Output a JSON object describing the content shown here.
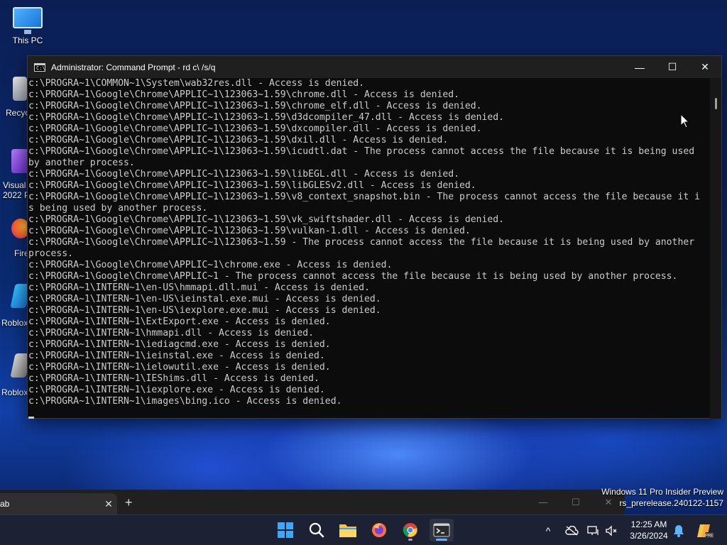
{
  "desktop": {
    "icons": [
      {
        "label": "This PC"
      },
      {
        "label": "Recyc"
      },
      {
        "label": "Visual\n2022 P"
      },
      {
        "label": "Fire"
      },
      {
        "label": "Roblox"
      },
      {
        "label": "Roblox"
      }
    ]
  },
  "window": {
    "title": "Administrator: Command Prompt - rd  c\\ /s/q",
    "minimize_symbol": "—",
    "maximize_symbol": "☐",
    "close_symbol": "✕"
  },
  "console": {
    "lines": [
      "c:\\PROGRA~1\\COMMON~1\\System\\wab32res.dll - Access is denied.",
      "c:\\PROGRA~1\\Google\\Chrome\\APPLIC~1\\123063~1.59\\chrome.dll - Access is denied.",
      "c:\\PROGRA~1\\Google\\Chrome\\APPLIC~1\\123063~1.59\\chrome_elf.dll - Access is denied.",
      "c:\\PROGRA~1\\Google\\Chrome\\APPLIC~1\\123063~1.59\\d3dcompiler_47.dll - Access is denied.",
      "c:\\PROGRA~1\\Google\\Chrome\\APPLIC~1\\123063~1.59\\dxcompiler.dll - Access is denied.",
      "c:\\PROGRA~1\\Google\\Chrome\\APPLIC~1\\123063~1.59\\dxil.dll - Access is denied.",
      "c:\\PROGRA~1\\Google\\Chrome\\APPLIC~1\\123063~1.59\\icudtl.dat - The process cannot access the file because it is being used",
      "by another process.",
      "c:\\PROGRA~1\\Google\\Chrome\\APPLIC~1\\123063~1.59\\libEGL.dll - Access is denied.",
      "c:\\PROGRA~1\\Google\\Chrome\\APPLIC~1\\123063~1.59\\libGLESv2.dll - Access is denied.",
      "c:\\PROGRA~1\\Google\\Chrome\\APPLIC~1\\123063~1.59\\v8_context_snapshot.bin - The process cannot access the file because it i",
      "s being used by another process.",
      "c:\\PROGRA~1\\Google\\Chrome\\APPLIC~1\\123063~1.59\\vk_swiftshader.dll - Access is denied.",
      "c:\\PROGRA~1\\Google\\Chrome\\APPLIC~1\\123063~1.59\\vulkan-1.dll - Access is denied.",
      "c:\\PROGRA~1\\Google\\Chrome\\APPLIC~1\\123063~1.59 - The process cannot access the file because it is being used by another",
      "process.",
      "c:\\PROGRA~1\\Google\\Chrome\\APPLIC~1\\chrome.exe - Access is denied.",
      "c:\\PROGRA~1\\Google\\Chrome\\APPLIC~1 - The process cannot access the file because it is being used by another process.",
      "c:\\PROGRA~1\\INTERN~1\\en-US\\hmmapi.dll.mui - Access is denied.",
      "c:\\PROGRA~1\\INTERN~1\\en-US\\ieinstal.exe.mui - Access is denied.",
      "c:\\PROGRA~1\\INTERN~1\\en-US\\iexplore.exe.mui - Access is denied.",
      "c:\\PROGRA~1\\INTERN~1\\ExtExport.exe - Access is denied.",
      "c:\\PROGRA~1\\INTERN~1\\hmmapi.dll - Access is denied.",
      "c:\\PROGRA~1\\INTERN~1\\iediagcmd.exe - Access is denied.",
      "c:\\PROGRA~1\\INTERN~1\\ieinstal.exe - Access is denied.",
      "c:\\PROGRA~1\\INTERN~1\\ielowutil.exe - Access is denied.",
      "c:\\PROGRA~1\\INTERN~1\\IEShims.dll - Access is denied.",
      "c:\\PROGRA~1\\INTERN~1\\iexplore.exe - Access is denied.",
      "c:\\PROGRA~1\\INTERN~1\\images\\bing.ico - Access is denied."
    ]
  },
  "browser": {
    "tab_title": "ab",
    "tab_close": "✕",
    "new_tab": "+",
    "minimize_symbol": "—",
    "maximize_symbol": "☐",
    "close_symbol": "✕"
  },
  "watermark": {
    "line1": "Windows 11 Pro Insider Preview",
    "line2": "rs_prerelease.240122-1157"
  },
  "taskbar": {
    "apps": [
      "start-icon",
      "search-icon",
      "file-explorer-icon",
      "firefox-icon",
      "chrome-icon",
      "terminal-icon"
    ],
    "tray_overflow": "^",
    "time": "12:25 AM",
    "date": "3/26/2024"
  },
  "colors": {
    "console_bg": "#0c0c0c",
    "console_text": "#cccccc",
    "titlebar_bg": "#1f1f1f",
    "taskbar_bg": "#1c2233",
    "accent": "#5fb2ff"
  }
}
